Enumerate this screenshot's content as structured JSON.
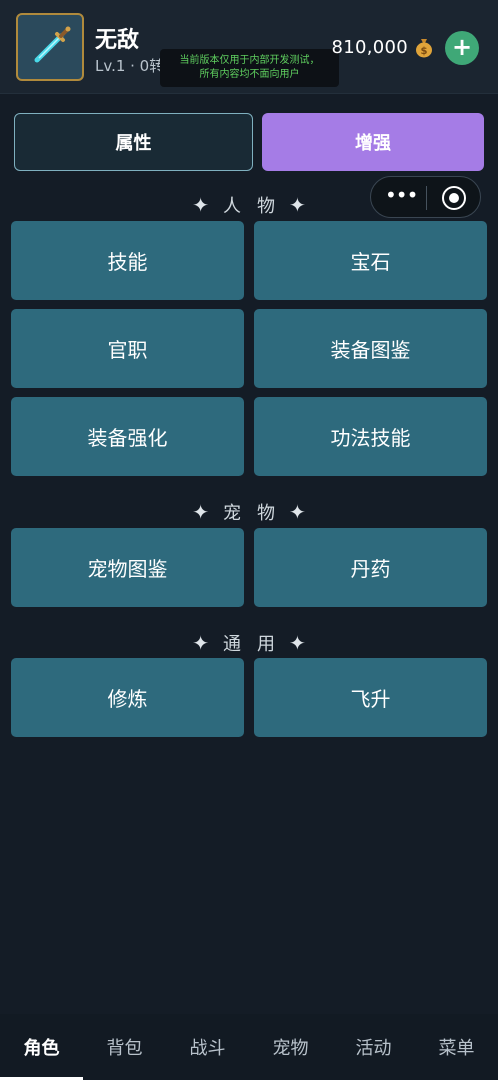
{
  "header": {
    "player_name": "无敌",
    "level_text": "Lv.1 · 0转",
    "dev_notice_line1": "当前版本仅用于内部开发测试，",
    "dev_notice_line2": "所有内容均不面向用户",
    "gold_amount": "810,000",
    "gold_icon": "money-bag-icon",
    "add_label": "+"
  },
  "tabs": [
    {
      "label": "属性",
      "active": false
    },
    {
      "label": "增强",
      "active": true
    }
  ],
  "capsule": {
    "more_label": "•••",
    "icons": [
      "more-icon",
      "target-icon"
    ]
  },
  "sections": [
    {
      "title": "人物",
      "buttons": [
        "技能",
        "宝石",
        "官职",
        "装备图鉴",
        "装备强化",
        "功法技能"
      ]
    },
    {
      "title": "宠物",
      "buttons": [
        "宠物图鉴",
        "丹药"
      ]
    },
    {
      "title": "通用",
      "buttons": [
        "修炼",
        "飞升"
      ]
    }
  ],
  "bottom_nav": {
    "items": [
      "角色",
      "背包",
      "战斗",
      "宠物",
      "活动",
      "菜单"
    ],
    "active_index": 0
  },
  "colors": {
    "background": "#141c26",
    "button": "#2e6a7d",
    "active_tab": "#a57ce6",
    "add_button": "#3fa877",
    "dev_notice_text": "#5fcf5f"
  }
}
